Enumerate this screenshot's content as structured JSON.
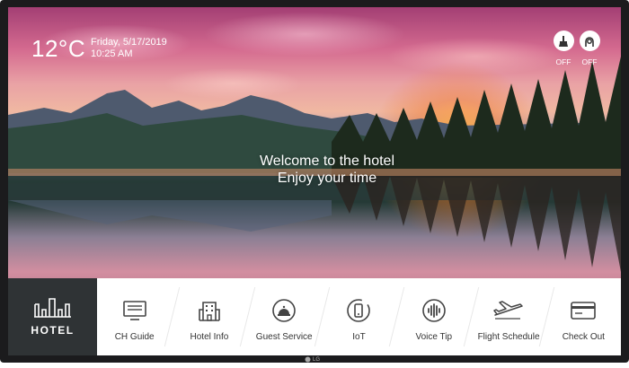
{
  "header": {
    "temperature": "12°C",
    "date": "Friday, 5/17/2019",
    "time": "10:25 AM"
  },
  "toggles": [
    {
      "icon": "do-not-disturb-icon",
      "state": "OFF"
    },
    {
      "icon": "makeup-room-icon",
      "state": "OFF"
    }
  ],
  "welcome": {
    "line1": "Welcome to the hotel",
    "line2": "Enjoy your time"
  },
  "brand": {
    "label": "HOTEL",
    "tv_logo": "LG"
  },
  "menu": [
    {
      "label": "CH Guide",
      "icon": "tv-icon"
    },
    {
      "label": "Hotel Info",
      "icon": "building-icon"
    },
    {
      "label": "Guest Service",
      "icon": "bell-icon"
    },
    {
      "label": "IoT",
      "icon": "phone-icon"
    },
    {
      "label": "Voice Tip",
      "icon": "microphone-icon"
    },
    {
      "label": "Flight Schedule",
      "icon": "airplane-icon"
    },
    {
      "label": "Check Out",
      "icon": "card-icon"
    }
  ],
  "colors": {
    "bezel": "#1b1b1d",
    "logo_tile": "#2f3335",
    "menu_bar": "#ffffff"
  }
}
